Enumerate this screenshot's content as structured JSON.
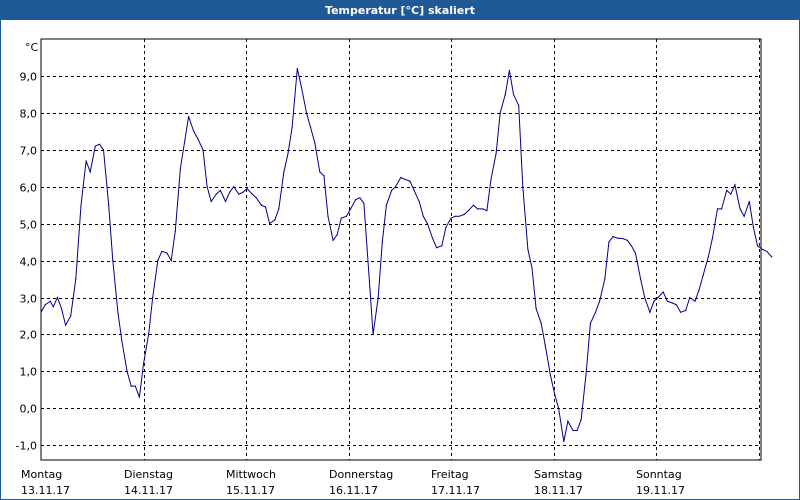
{
  "window": {
    "title": "Temperatur [°C] skaliert"
  },
  "colors": {
    "titlebar": "#1f5a96",
    "line": "#00008b",
    "grid": "#000000"
  },
  "chart_data": {
    "type": "line",
    "title": "Temperatur [°C] skaliert",
    "ylabel": "°C",
    "xlabel": "",
    "ylim": [
      -1.4,
      10.0
    ],
    "xlim": [
      0,
      7
    ],
    "grid": true,
    "yticks": [
      -1.0,
      0.0,
      1.0,
      2.0,
      3.0,
      4.0,
      5.0,
      6.0,
      7.0,
      8.0,
      9.0
    ],
    "ytick_labels": [
      "-1,0",
      "0,0",
      "1,0",
      "2,0",
      "3,0",
      "4,0",
      "5,0",
      "6,0",
      "7,0",
      "8,0",
      "9,0"
    ],
    "xticks": [
      0,
      1,
      2,
      3,
      4,
      5,
      6,
      7
    ],
    "day_labels": [
      {
        "day": "Montag",
        "date": "13.11.17"
      },
      {
        "day": "Dienstag",
        "date": "14.11.17"
      },
      {
        "day": "Mittwoch",
        "date": "15.11.17"
      },
      {
        "day": "Donnerstag",
        "date": "16.11.17"
      },
      {
        "day": "Freitag",
        "date": "17.11.17"
      },
      {
        "day": "Samstag",
        "date": "18.11.17"
      },
      {
        "day": "Sonntag",
        "date": "19.11.17"
      }
    ],
    "series": [
      {
        "values": [
          [
            0.0,
            2.6
          ],
          [
            0.04,
            2.8
          ],
          [
            0.09,
            2.9
          ],
          [
            0.12,
            2.75
          ],
          [
            0.16,
            3.0
          ],
          [
            0.2,
            2.7
          ],
          [
            0.24,
            2.25
          ],
          [
            0.29,
            2.5
          ],
          [
            0.34,
            3.5
          ],
          [
            0.39,
            5.5
          ],
          [
            0.44,
            6.7
          ],
          [
            0.48,
            6.4
          ],
          [
            0.53,
            7.1
          ],
          [
            0.57,
            7.15
          ],
          [
            0.61,
            7.0
          ],
          [
            0.66,
            5.5
          ],
          [
            0.7,
            4.0
          ],
          [
            0.75,
            2.6
          ],
          [
            0.79,
            1.8
          ],
          [
            0.84,
            1.0
          ],
          [
            0.88,
            0.6
          ],
          [
            0.92,
            0.6
          ],
          [
            0.96,
            0.3
          ],
          [
            1.0,
            1.2
          ],
          [
            1.05,
            2.0
          ],
          [
            1.09,
            3.0
          ],
          [
            1.14,
            4.0
          ],
          [
            1.18,
            4.25
          ],
          [
            1.23,
            4.2
          ],
          [
            1.27,
            4.0
          ],
          [
            1.31,
            4.8
          ],
          [
            1.36,
            6.5
          ],
          [
            1.4,
            7.2
          ],
          [
            1.44,
            7.9
          ],
          [
            1.49,
            7.5
          ],
          [
            1.53,
            7.3
          ],
          [
            1.58,
            7.0
          ],
          [
            1.62,
            6.0
          ],
          [
            1.66,
            5.6
          ],
          [
            1.71,
            5.8
          ],
          [
            1.75,
            5.9
          ],
          [
            1.8,
            5.6
          ],
          [
            1.84,
            5.85
          ],
          [
            1.88,
            6.0
          ],
          [
            1.93,
            5.8
          ],
          [
            1.97,
            5.85
          ],
          [
            2.01,
            5.95
          ],
          [
            2.06,
            5.8
          ],
          [
            2.1,
            5.7
          ],
          [
            2.15,
            5.5
          ],
          [
            2.19,
            5.45
          ],
          [
            2.23,
            5.0
          ],
          [
            2.28,
            5.1
          ],
          [
            2.32,
            5.4
          ],
          [
            2.37,
            6.4
          ],
          [
            2.41,
            6.9
          ],
          [
            2.45,
            7.6
          ],
          [
            2.5,
            9.2
          ],
          [
            2.54,
            8.7
          ],
          [
            2.59,
            8.0
          ],
          [
            2.63,
            7.6
          ],
          [
            2.67,
            7.2
          ],
          [
            2.72,
            6.4
          ],
          [
            2.76,
            6.3
          ],
          [
            2.8,
            5.2
          ],
          [
            2.85,
            4.55
          ],
          [
            2.89,
            4.7
          ],
          [
            2.93,
            5.15
          ],
          [
            2.98,
            5.2
          ],
          [
            3.02,
            5.4
          ],
          [
            3.07,
            5.65
          ],
          [
            3.11,
            5.7
          ],
          [
            3.15,
            5.55
          ],
          [
            3.2,
            3.6
          ],
          [
            3.24,
            2.0
          ],
          [
            3.29,
            3.0
          ],
          [
            3.33,
            4.5
          ],
          [
            3.37,
            5.5
          ],
          [
            3.42,
            5.9
          ],
          [
            3.46,
            6.0
          ],
          [
            3.51,
            6.25
          ],
          [
            3.55,
            6.2
          ],
          [
            3.6,
            6.15
          ],
          [
            3.64,
            5.9
          ],
          [
            3.69,
            5.6
          ],
          [
            3.73,
            5.2
          ],
          [
            3.77,
            5.0
          ],
          [
            3.82,
            4.6
          ],
          [
            3.86,
            4.35
          ],
          [
            3.91,
            4.4
          ],
          [
            3.95,
            4.9
          ],
          [
            4.0,
            5.15
          ],
          [
            4.04,
            5.2
          ],
          [
            4.08,
            5.2
          ],
          [
            4.13,
            5.25
          ],
          [
            4.17,
            5.35
          ],
          [
            4.22,
            5.5
          ],
          [
            4.26,
            5.4
          ],
          [
            4.31,
            5.4
          ],
          [
            4.35,
            5.35
          ],
          [
            4.39,
            6.2
          ],
          [
            4.44,
            6.9
          ],
          [
            4.48,
            8.0
          ],
          [
            4.53,
            8.5
          ],
          [
            4.57,
            9.15
          ],
          [
            4.61,
            8.5
          ],
          [
            4.66,
            8.2
          ],
          [
            4.7,
            6.0
          ],
          [
            4.75,
            4.3
          ],
          [
            4.79,
            3.8
          ],
          [
            4.83,
            2.7
          ],
          [
            4.88,
            2.3
          ],
          [
            4.92,
            1.7
          ],
          [
            4.97,
            0.9
          ],
          [
            5.01,
            0.4
          ],
          [
            5.05,
            0.0
          ],
          [
            5.1,
            -0.9
          ],
          [
            5.14,
            -0.35
          ],
          [
            5.19,
            -0.6
          ],
          [
            5.23,
            -0.6
          ],
          [
            5.27,
            -0.3
          ],
          [
            5.32,
            1.0
          ],
          [
            5.36,
            2.3
          ],
          [
            5.41,
            2.6
          ],
          [
            5.45,
            2.9
          ],
          [
            5.5,
            3.5
          ],
          [
            5.54,
            4.5
          ],
          [
            5.58,
            4.65
          ],
          [
            5.63,
            4.6
          ],
          [
            5.67,
            4.6
          ],
          [
            5.72,
            4.55
          ],
          [
            5.76,
            4.4
          ],
          [
            5.8,
            4.2
          ],
          [
            5.85,
            3.5
          ],
          [
            5.89,
            3.0
          ],
          [
            5.94,
            2.6
          ],
          [
            5.98,
            2.9
          ],
          [
            6.02,
            3.0
          ],
          [
            6.07,
            3.15
          ],
          [
            6.11,
            2.9
          ],
          [
            6.16,
            2.85
          ],
          [
            6.2,
            2.8
          ],
          [
            6.24,
            2.6
          ],
          [
            6.29,
            2.65
          ],
          [
            6.33,
            3.0
          ],
          [
            6.38,
            2.9
          ],
          [
            6.42,
            3.2
          ],
          [
            6.46,
            3.6
          ],
          [
            6.51,
            4.1
          ],
          [
            6.55,
            4.6
          ],
          [
            6.6,
            5.4
          ],
          [
            6.64,
            5.4
          ],
          [
            6.69,
            5.9
          ],
          [
            6.73,
            5.8
          ],
          [
            6.77,
            6.05
          ],
          [
            6.82,
            5.4
          ],
          [
            6.86,
            5.2
          ],
          [
            6.91,
            5.6
          ],
          [
            6.95,
            4.9
          ],
          [
            6.99,
            4.4
          ],
          [
            7.04,
            4.3
          ],
          [
            7.08,
            4.25
          ],
          [
            7.13,
            4.1
          ]
        ]
      }
    ]
  }
}
